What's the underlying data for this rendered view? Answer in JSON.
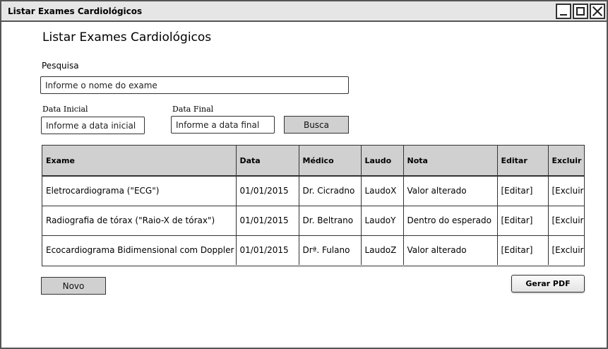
{
  "window": {
    "title": "Listar Exames Cardiológicos"
  },
  "page": {
    "title": "Listar Exames Cardiológicos"
  },
  "search": {
    "label": "Pesquisa",
    "placeholder": "Informe o nome do exame"
  },
  "date_start": {
    "label": "Data Inicial",
    "placeholder": "Informe a data inicial"
  },
  "date_end": {
    "label": "Data Final",
    "placeholder": "Informe a data final"
  },
  "buttons": {
    "search": "Busca",
    "new": "Novo",
    "pdf": "Gerar PDF"
  },
  "table": {
    "headers": [
      "Exame",
      "Data",
      "Médico",
      "Laudo",
      "Nota",
      "Editar",
      "Excluir"
    ],
    "rows": [
      [
        "Eletrocardiograma (\"ECG\")",
        "01/01/2015",
        "Dr. Cicradno",
        "LaudoX",
        "Valor alterado",
        "[Editar]",
        "[Excluir]"
      ],
      [
        "Radiografia de tórax (\"Raio-X de tórax\")",
        "01/01/2015",
        "Dr. Beltrano",
        "LaudoY",
        "Dentro do esperado",
        "[Editar]",
        "[Excluir]"
      ],
      [
        "Ecocardiograma Bidimensional com Doppler",
        "01/01/2015",
        "Drª. Fulano",
        "LaudoZ",
        "Valor alterado",
        "[Editar]",
        "[Excluir]"
      ]
    ]
  }
}
